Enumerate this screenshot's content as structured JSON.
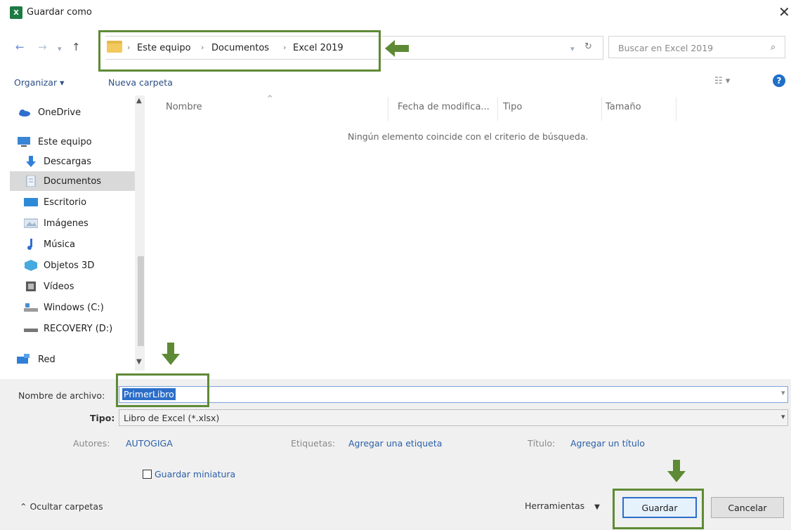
{
  "window": {
    "title": "Guardar como",
    "app_icon_text": "X"
  },
  "address": {
    "crumbs": [
      "Este equipo",
      "Documentos",
      "Excel 2019"
    ],
    "search_placeholder": "Buscar en Excel 2019"
  },
  "toolbar": {
    "organize": "Organizar ▾",
    "new_folder": "Nueva carpeta"
  },
  "sidebar": {
    "items": [
      {
        "label": "OneDrive",
        "icon": "onedrive-icon",
        "color": "#2e6fd0"
      },
      {
        "label": "Este equipo",
        "icon": "computer-icon",
        "color": "#3a86d6"
      },
      {
        "label": "Descargas",
        "icon": "download-icon",
        "color": "#2f7fd8"
      },
      {
        "label": "Documentos",
        "icon": "documents-icon",
        "color": "#c8d6e8"
      },
      {
        "label": "Escritorio",
        "icon": "desktop-icon",
        "color": "#2e8ad8"
      },
      {
        "label": "Imágenes",
        "icon": "pictures-icon",
        "color": "#9fb7cf"
      },
      {
        "label": "Música",
        "icon": "music-icon",
        "color": "#2f6ed0"
      },
      {
        "label": "Objetos 3D",
        "icon": "3d-objects-icon",
        "color": "#46a9e0"
      },
      {
        "label": "Vídeos",
        "icon": "videos-icon",
        "color": "#5a5a5a"
      },
      {
        "label": "Windows (C:)",
        "icon": "drive-c-icon",
        "color": "#4a8fcf"
      },
      {
        "label": "RECOVERY (D:)",
        "icon": "drive-d-icon",
        "color": "#777777"
      },
      {
        "label": "Red",
        "icon": "network-icon",
        "color": "#2f7fd8"
      }
    ],
    "selected_index": 3
  },
  "columns": {
    "name": "Nombre",
    "date": "Fecha de modifica...",
    "type": "Tipo",
    "size": "Tamaño"
  },
  "empty_message": "Ningún elemento coincide con el criterio de búsqueda.",
  "form": {
    "filename_label": "Nombre de archivo:",
    "filename_value": "PrimerLibro",
    "type_label": "Tipo:",
    "type_value": "Libro de Excel (*.xlsx)",
    "authors_label": "Autores:",
    "authors_value": "AUTOGIGA",
    "tags_label": "Etiquetas:",
    "tags_value": "Agregar una etiqueta",
    "title_label": "Título:",
    "title_value": "Agregar un título",
    "thumbnail_label": "Guardar miniatura"
  },
  "footer": {
    "hide_folders": "Ocultar carpetas",
    "tools": "Herramientas",
    "save": "Guardar",
    "cancel": "Cancelar"
  },
  "colors": {
    "annotation_green": "#5e8a35",
    "link_blue": "#2b5fa8",
    "selection_blue": "#2c6ec9"
  }
}
